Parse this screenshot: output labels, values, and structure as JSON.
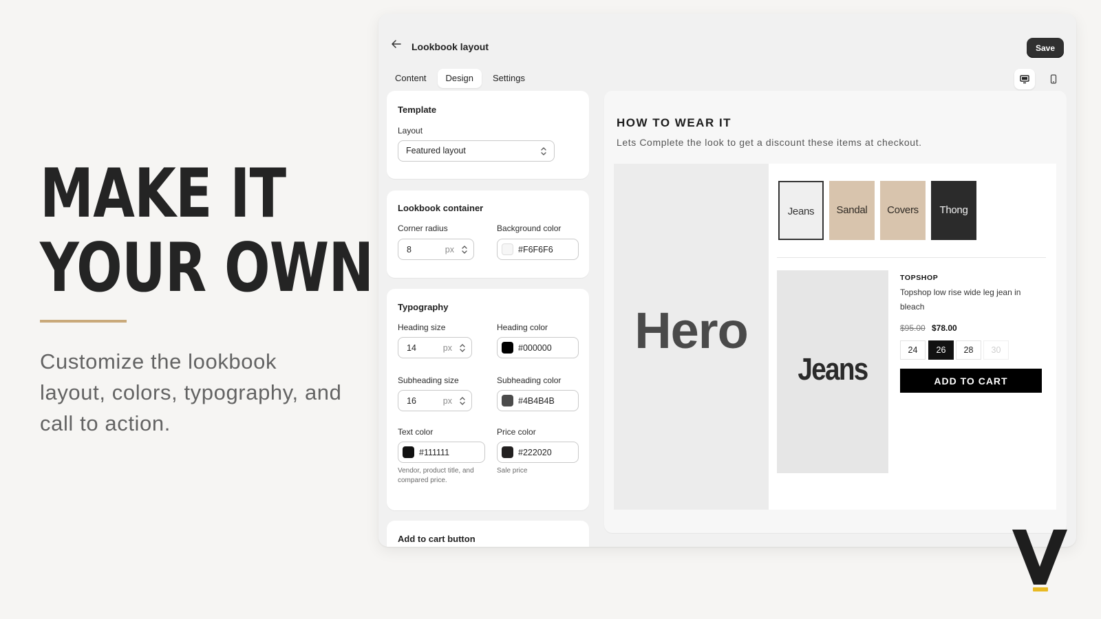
{
  "marketing": {
    "headline_line1": "MAKE IT",
    "headline_line2": "YOUR OWN",
    "subtext": "Customize the lookbook layout, colors, typography, and call to action.",
    "accent_color": "#C9A97A"
  },
  "window": {
    "title": "Lookbook layout",
    "save_label": "Save",
    "back_icon": "arrow-left-icon"
  },
  "tabs": [
    {
      "label": "Content",
      "active": false
    },
    {
      "label": "Design",
      "active": true
    },
    {
      "label": "Settings",
      "active": false
    }
  ],
  "view_toggle": [
    {
      "icon": "desktop-icon",
      "active": true
    },
    {
      "icon": "mobile-icon",
      "active": false
    }
  ],
  "template": {
    "title": "Template",
    "layout_label": "Layout",
    "layout_value": "Featured layout"
  },
  "container": {
    "title": "Lookbook container",
    "radius_label": "Corner radius",
    "radius_value": "8",
    "radius_unit": "px",
    "bg_label": "Background color",
    "bg_value": "#F6F6F6"
  },
  "typography": {
    "title": "Typography",
    "heading_size_label": "Heading size",
    "heading_size_value": "14",
    "heading_size_unit": "px",
    "heading_color_label": "Heading color",
    "heading_color_value": "#000000",
    "subheading_size_label": "Subheading size",
    "subheading_size_value": "16",
    "subheading_size_unit": "px",
    "subheading_color_label": "Subheading color",
    "subheading_color_value": "#4B4B4B",
    "text_color_label": "Text color",
    "text_color_value": "#111111",
    "text_color_help": "Vendor, product title, and compared price.",
    "price_color_label": "Price color",
    "price_color_value": "#222020",
    "price_color_help": "Sale price"
  },
  "add_to_cart_section": {
    "title": "Add to cart button"
  },
  "preview": {
    "heading": "HOW TO WEAR IT",
    "subheading": "Lets Complete the look to get a discount these items at checkout.",
    "hero_text": "Hero",
    "thumbnails": [
      {
        "label": "Jeans",
        "selected": true
      },
      {
        "label": "Sandal",
        "selected": false
      },
      {
        "label": "Covers",
        "selected": false
      },
      {
        "label": "Thong",
        "selected": false
      }
    ],
    "product": {
      "image_text": "Jeans",
      "vendor": "TOPSHOP",
      "title": "Topshop low rise wide leg jean in bleach",
      "compare_price": "$95.00",
      "price": "$78.00",
      "sizes": [
        "24",
        "26",
        "28",
        "30"
      ],
      "selected_size": "26",
      "disabled_size": "30",
      "add_to_cart_label": "ADD TO CART"
    }
  }
}
